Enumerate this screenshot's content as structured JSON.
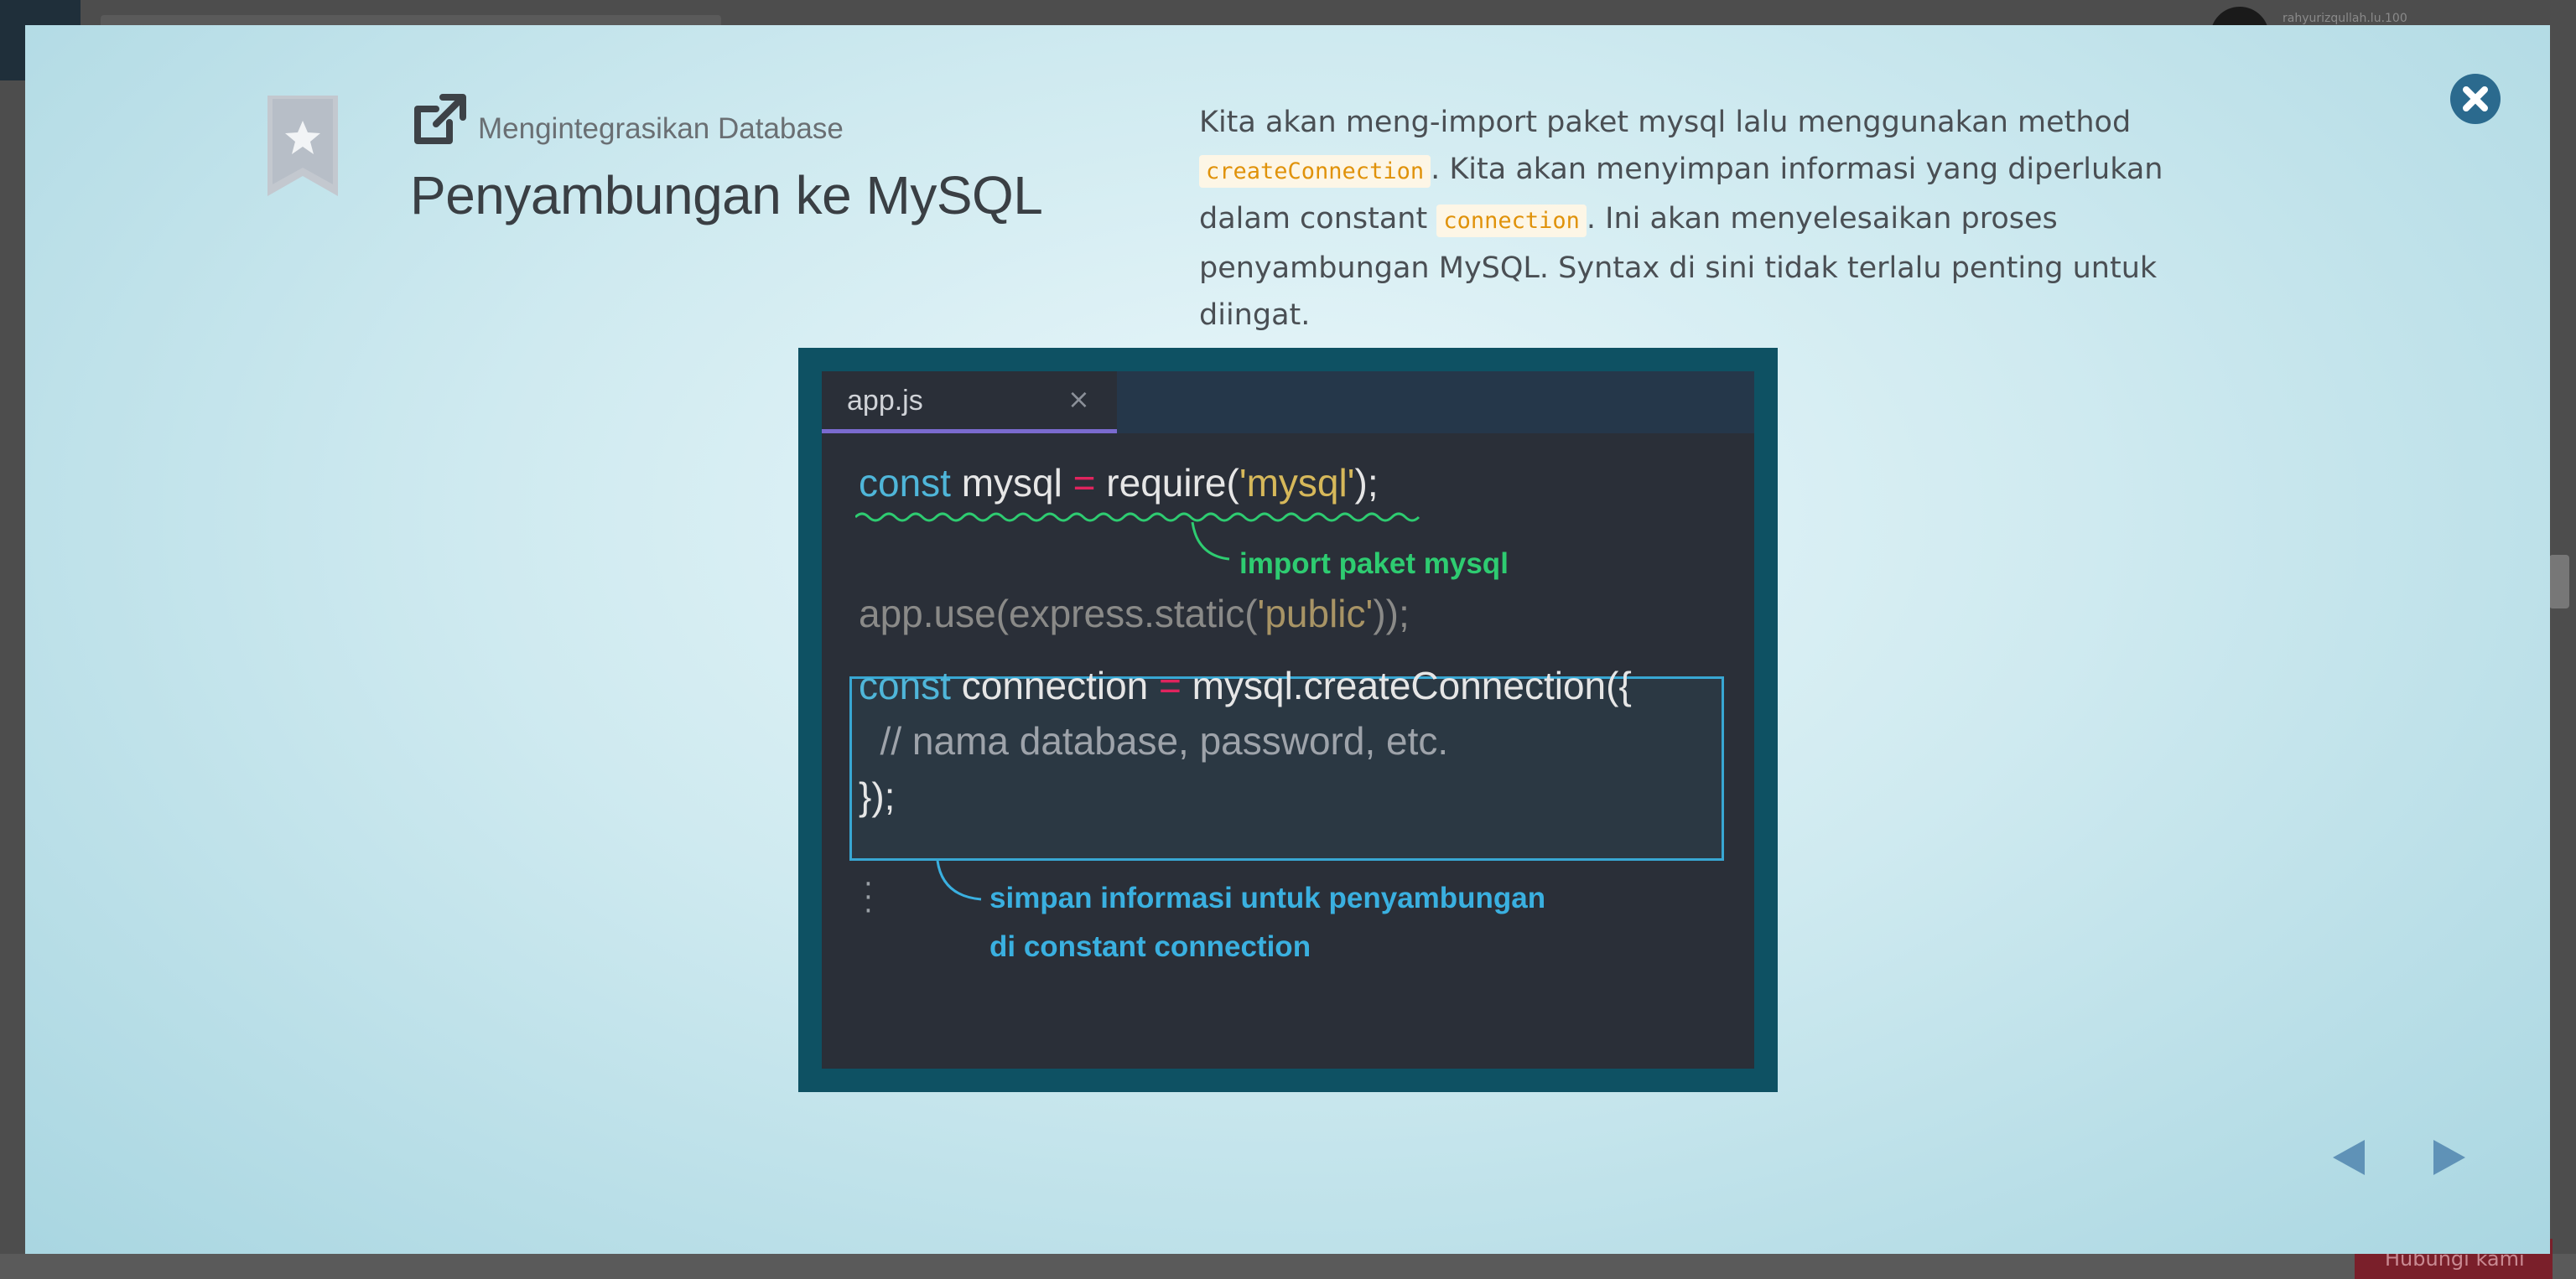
{
  "background": {
    "username": "rahyurizqullah.lu.100",
    "bottom_button_label": "Hubungi kami"
  },
  "modal": {
    "section_label": "Mengintegrasikan Database",
    "lesson_title": "Penyambungan ke MySQL",
    "description": {
      "part1": "Kita akan meng-import paket mysql lalu menggunakan method ",
      "code1": "createConnection",
      "part2": ". Kita akan menyimpan informasi yang diperlukan dalam constant ",
      "code2": "connection",
      "part3": ". Ini akan menyelesaikan proses penyambungan MySQL. Syntax di sini tidak terlalu penting untuk diingat."
    },
    "icons": {
      "bookmark": "bookmark-star-icon",
      "share": "external-link-icon",
      "close": "close-icon",
      "prev": "arrow-left-icon",
      "next": "arrow-right-icon"
    }
  },
  "slide": {
    "tab_filename": "app.js",
    "tab_close": "×",
    "code": {
      "line1": {
        "kw": "const",
        "name": " mysql ",
        "op": "=",
        "call": " require(",
        "str": "'mysql'",
        "end": ");"
      },
      "line2": {
        "pre": "app.use(express.static(",
        "str": "'public'",
        "end": "));"
      },
      "line3": {
        "kw": "const",
        "name": " connection ",
        "op": "=",
        "call": " mysql.createConnection({"
      },
      "line4": "  // nama database, password, etc.",
      "line5": "});"
    },
    "annotation_green": "import paket mysql",
    "annotation_blue_line1": "simpan informasi untuk penyambungan",
    "annotation_blue_line2": "di constant connection",
    "colors": {
      "keyword": "#4fb6d9",
      "operator": "#e0245e",
      "string": "#d6b85a",
      "annotation_green": "#2ecc71",
      "annotation_blue": "#3ab0e0",
      "tab_underline": "#7a6bcf"
    }
  }
}
